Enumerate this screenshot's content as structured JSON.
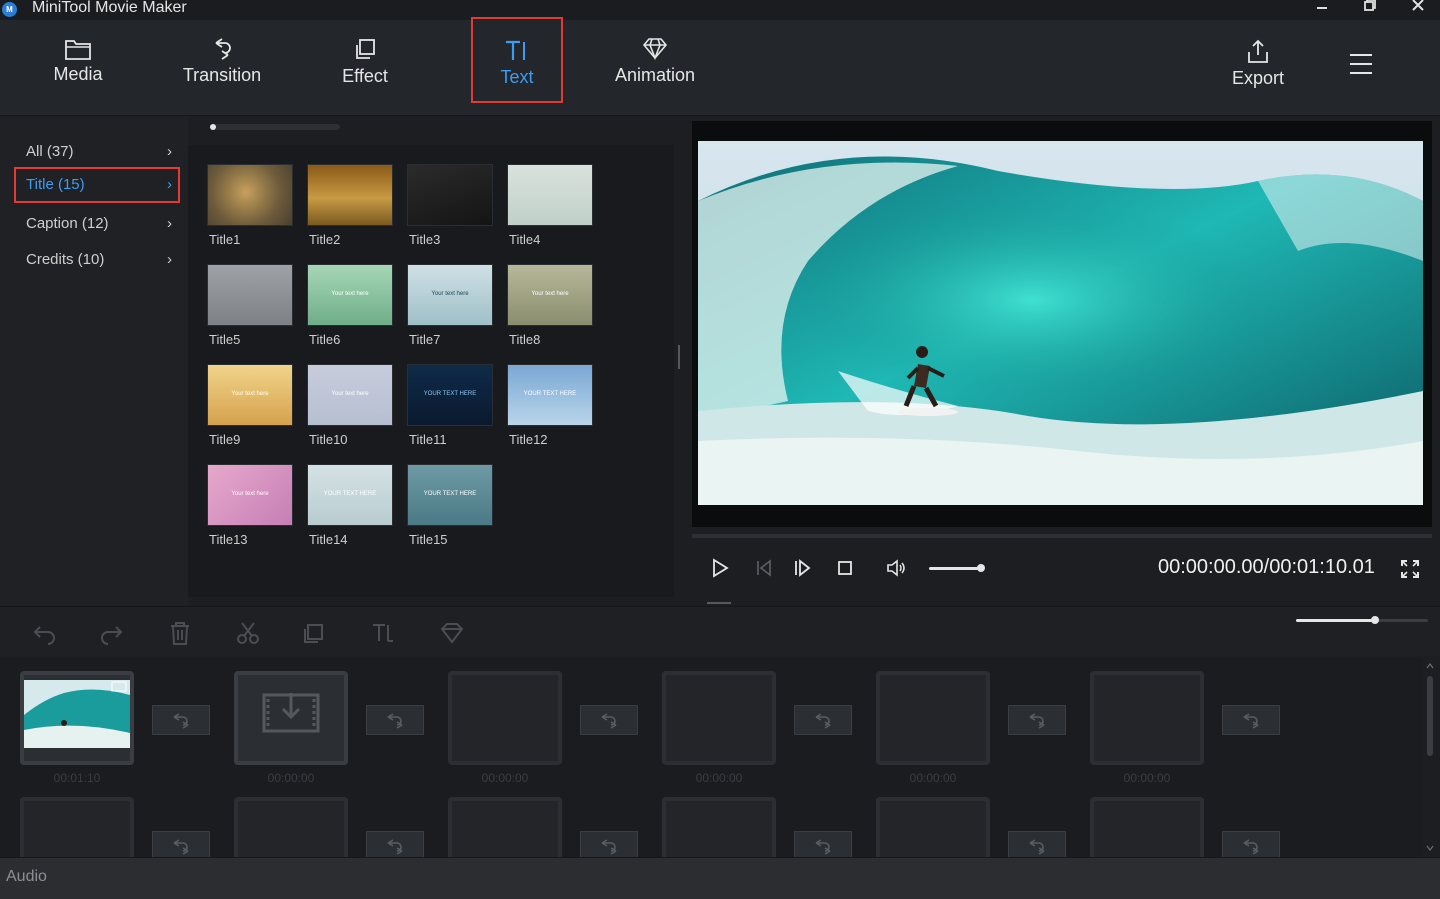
{
  "app": {
    "title": "MiniTool Movie Maker",
    "logo_letter": "M"
  },
  "toolbar": {
    "items": [
      {
        "label": "Media",
        "icon": "folder-icon"
      },
      {
        "label": "Transition",
        "icon": "transition-icon"
      },
      {
        "label": "Effect",
        "icon": "effect-icon"
      },
      {
        "label": "Text",
        "icon": "text-icon"
      },
      {
        "label": "Animation",
        "icon": "diamond-icon"
      }
    ],
    "export_label": "Export",
    "active": "Text",
    "accent_color": "#3c9cf0",
    "highlight_color": "#e53935"
  },
  "categories": [
    {
      "label": "All (37)"
    },
    {
      "label": "Title (15)"
    },
    {
      "label": "Caption (12)"
    },
    {
      "label": "Credits (10)"
    }
  ],
  "active_category": "Title (15)",
  "titles": [
    {
      "label": "Title1",
      "text": ""
    },
    {
      "label": "Title2",
      "text": ""
    },
    {
      "label": "Title3",
      "text": ""
    },
    {
      "label": "Title4",
      "text": ""
    },
    {
      "label": "Title5",
      "text": ""
    },
    {
      "label": "Title6",
      "text": "Your text here"
    },
    {
      "label": "Title7",
      "text": "Your text here"
    },
    {
      "label": "Title8",
      "text": "Your text here"
    },
    {
      "label": "Title9",
      "text": "Your text here"
    },
    {
      "label": "Title10",
      "text": "Your text here"
    },
    {
      "label": "Title11",
      "text": "YOUR TEXT HERE"
    },
    {
      "label": "Title12",
      "text": "YOUR TEXT HERE"
    },
    {
      "label": "Title13",
      "text": "Your text here"
    },
    {
      "label": "Title14",
      "text": "YOUR TEXT HERE"
    },
    {
      "label": "Title15",
      "text": "YOUR TEXT HERE"
    }
  ],
  "player": {
    "timecode": "00:00:00.00/00:01:10.01",
    "volume": 1.0
  },
  "timeline": {
    "zoom": 0.6,
    "clips": [
      {
        "time": "00:01:10"
      },
      {
        "time": "00:00:00"
      },
      {
        "time": "00:00:00"
      },
      {
        "time": "00:00:00"
      },
      {
        "time": "00:00:00"
      },
      {
        "time": "00:00:00"
      }
    ]
  },
  "audio": {
    "label": "Audio"
  }
}
